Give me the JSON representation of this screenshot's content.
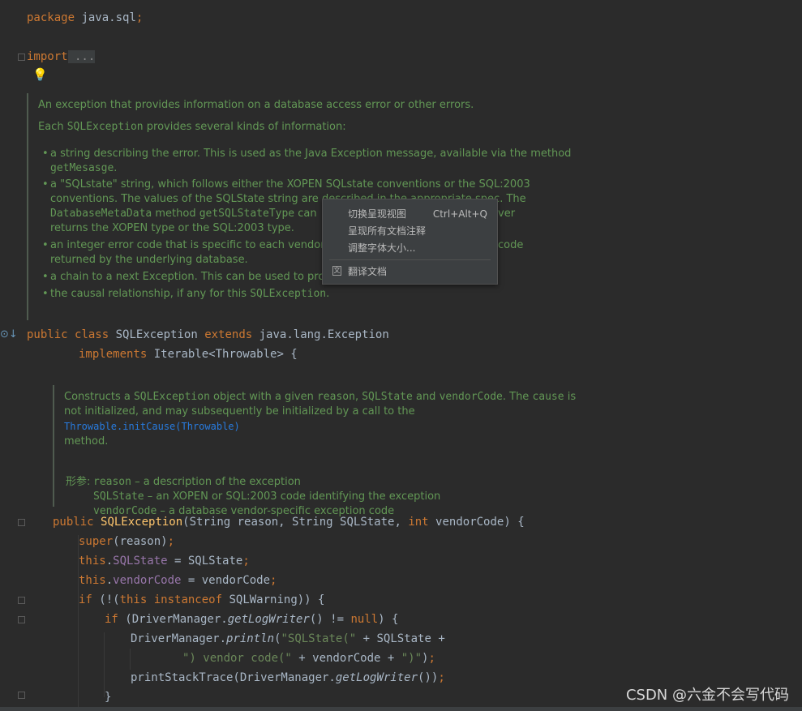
{
  "code": {
    "line_package": [
      "package",
      " java.sql",
      ";"
    ],
    "line_import": [
      "import",
      " ..."
    ],
    "class_decl": {
      "public": "public",
      "class": "class",
      "name": " SQLException ",
      "extends": "extends",
      "super": " java.lang.Exception"
    },
    "implements": {
      "kw": "implements",
      "rest": " Iterable<Throwable> {"
    },
    "ctor": {
      "public": "public",
      "name": "SQLException",
      "params_a": "(String reason, String SQLState, ",
      "int": "int",
      "params_b": " vendorCode) {"
    },
    "super_call": {
      "kw": "super",
      "rest": "(reason)",
      "semi": ";"
    },
    "assign1": {
      "kw": "this",
      "dot": ".",
      "field": "SQLState",
      "rest": " = SQLState",
      "semi": ";"
    },
    "assign2": {
      "kw": "this",
      "dot": ".",
      "field": "vendorCode",
      "rest": " = vendorCode",
      "semi": ";"
    },
    "if1": {
      "kw": "if",
      "a": " (!(",
      "this": "this",
      "sp": " ",
      "instanceof": "instanceof",
      "b": " SQLWarning)) {"
    },
    "if2": {
      "kw": "if",
      "a": " (DriverManager.",
      "call": "getLogWriter",
      "b": "() != ",
      "null": "null",
      "c": ") {"
    },
    "println": {
      "a": "DriverManager.",
      "call": "println",
      "b": "(",
      "s1": "\"SQLState(\"",
      "c": " + SQLState +"
    },
    "println2": {
      "s2": "\") vendor code(\"",
      "a": " + vendorCode + ",
      "s3": "\")\"",
      "b": ")",
      "semi": ";"
    },
    "stack": {
      "a": "printStackTrace(DriverManager.",
      "call": "getLogWriter",
      "b": "())",
      "semi": ";"
    },
    "close": "}"
  },
  "doc_class": {
    "p1": "An exception that provides information on a database access error or other errors.",
    "p2_a": "Each ",
    "p2_m": "SQLException",
    "p2_b": " provides several kinds of information:",
    "b1_a": "a string describing the error. This is used as the Java Exception message, available via the method",
    "b1_m": "getMesasge",
    "b1_b": ".",
    "b2_l1": "a \"SQLstate\" string, which follows either the XOPEN SQLstate conventions or the SQL:2003",
    "b2_l2": "conventions. The values of the SQLState string are described in the appropriate spec. The",
    "b2_m1": "DatabaseMetaData",
    "b2_l3a": " method ",
    "b2_m2": "getSQLStateType",
    "b2_l3b": " can",
    "b2_l3c": "ver",
    "b2_l4": "returns the XOPEN type or the SQL:2003 type.",
    "b3_l1a": "an integer error code that is specific to each vendor. N",
    "b3_l1b": "code",
    "b3_l2": "returned by the underlying database.",
    "b4": "a chain to a next Exception. This can be used to provid",
    "b5_a": "the causal relationship, if any for this ",
    "b5_m": "SQLException",
    "b5_b": "."
  },
  "doc_ctor": {
    "l1_a": "Constructs a ",
    "l1_m1": "SQLException",
    "l1_b": " object with a given ",
    "l1_m2": "reason",
    "l1_c": ", ",
    "l1_m3": "SQLState",
    "l1_d": " and ",
    "l1_m4": "vendorCode",
    "l1_e": ". The ",
    "l1_m5": "cause",
    "l1_f": " is",
    "l2_a": "not initialized, and may subsequently be initialized by a call to the ",
    "l2_lnk": "Throwable.initCause(Throwable)",
    "l3": "method.",
    "params_label": "形参:",
    "p1_m": "reason",
    "p1": " – a description of the exception",
    "p2_m": "SQLState",
    "p2": " – an XOPEN or SQL:2003 code identifying the exception",
    "p3_m": "vendorCode",
    "p3": " – a database vendor-specific exception code"
  },
  "context_menu": {
    "items": [
      {
        "label": "切换呈现视图",
        "shortcut": "Ctrl+Alt+Q"
      },
      {
        "label": "呈现所有文档注释",
        "shortcut": ""
      },
      {
        "label": "调整字体大小...",
        "shortcut": ""
      },
      {
        "label": "翻译文档",
        "shortcut": ""
      }
    ]
  },
  "watermark": "CSDN @六金不会写代码",
  "colors": {
    "background": "#2b2b2b",
    "keyword": "#cc7832",
    "function": "#ffc66d",
    "doc": "#629755",
    "menu_bg": "#3c3f41"
  }
}
